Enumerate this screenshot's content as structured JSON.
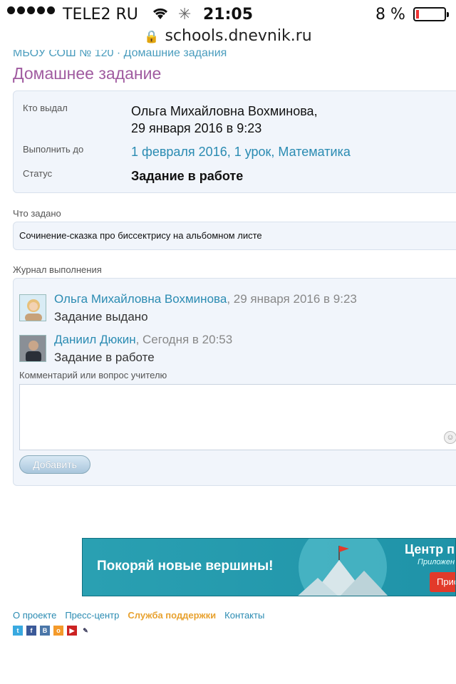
{
  "status_bar": {
    "carrier": "TELE2 RU",
    "time": "21:05",
    "battery": "8 %",
    "battery_level": 0.08
  },
  "browser": {
    "url": "schools.dnevnik.ru"
  },
  "page": {
    "breadcrumb": "МБОУ СОШ № 120 · Домашние задания",
    "title": "Домашнее задание"
  },
  "assignment": {
    "issued_by_label": "Кто выдал",
    "issued_by_name": "Ольга Михайловна Вохминова,",
    "issued_by_date": "29 января 2016 в 9:23",
    "due_label": "Выполнить до",
    "due_value": "1 февраля 2016, 1 урок, Математика",
    "status_label": "Статус",
    "status_value": "Задание в работе"
  },
  "task": {
    "label": "Что задано",
    "text": "Сочинение-сказка про биссектрису на альбомном листе"
  },
  "journal": {
    "label": "Журнал выполнения",
    "entries": [
      {
        "name": "Ольга Михайловна Вохминова",
        "date": ", 29 января 2016 в 9:23",
        "action": "Задание выдано"
      },
      {
        "name": "Даниил Дюкин",
        "date": ", Сегодня в 20:53",
        "action": "Задание в работе"
      }
    ],
    "comment_label": "Комментарий или вопрос учителю",
    "add_button": "Добавить"
  },
  "banner": {
    "slogan": "Покоряй новые вершины!",
    "right_title": "Центр п",
    "right_sub": "Приложен",
    "right_button": "Прис"
  },
  "footer": {
    "links": [
      "О проекте",
      "Пресс-центр",
      "Служба поддержки",
      "Контакты"
    ],
    "social_icons": [
      "twitter-icon",
      "facebook-icon",
      "vkontakte-icon",
      "odnoklassniki-icon",
      "youtube-icon",
      "livejournal-icon"
    ]
  }
}
